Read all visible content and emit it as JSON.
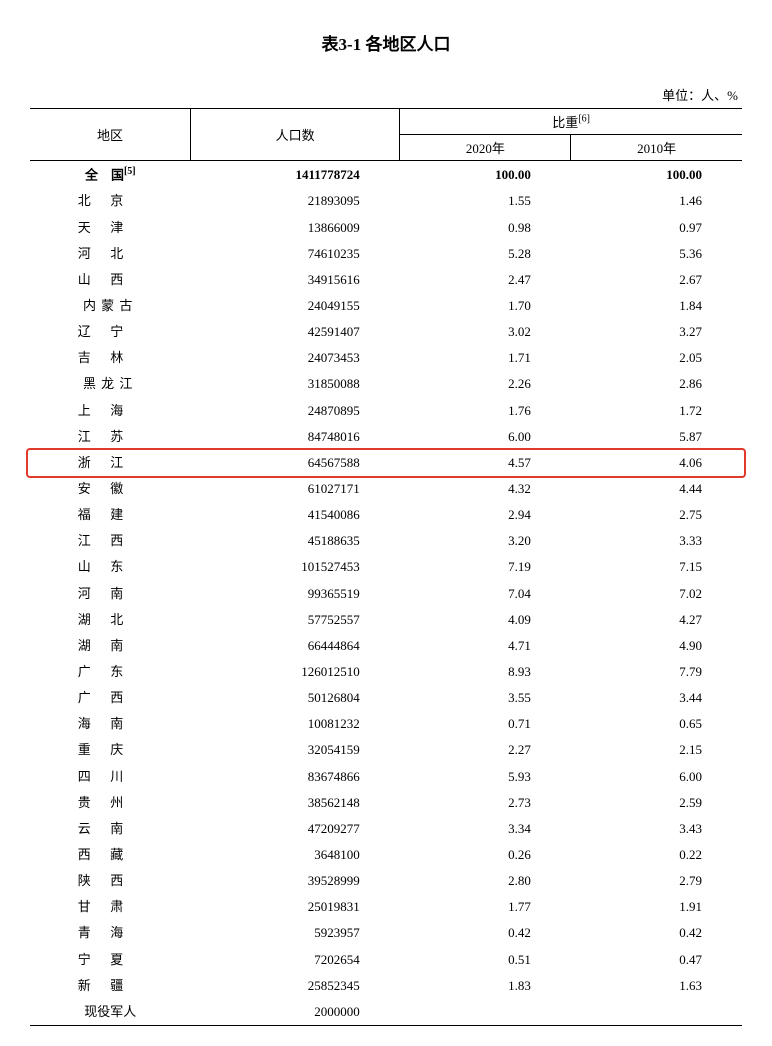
{
  "title": "表3-1 各地区人口",
  "unit_label": "单位：人、%",
  "headers": {
    "region": "地区",
    "population": "人口数",
    "share_group": "比重",
    "share_note": "[6]",
    "year_2020": "2020年",
    "year_2010": "2010年"
  },
  "total_row": {
    "region": "全　国",
    "note": "[5]",
    "population": "1411778724",
    "share_2020": "100.00",
    "share_2010": "100.00"
  },
  "rows": [
    {
      "region": "北京",
      "s": "s2",
      "population": "21893095",
      "share_2020": "1.55",
      "share_2010": "1.46"
    },
    {
      "region": "天津",
      "s": "s2",
      "population": "13866009",
      "share_2020": "0.98",
      "share_2010": "0.97"
    },
    {
      "region": "河北",
      "s": "s2",
      "population": "74610235",
      "share_2020": "5.28",
      "share_2010": "5.36"
    },
    {
      "region": "山西",
      "s": "s2",
      "population": "34915616",
      "share_2020": "2.47",
      "share_2010": "2.67"
    },
    {
      "region": "内蒙古",
      "s": "s3",
      "population": "24049155",
      "share_2020": "1.70",
      "share_2010": "1.84"
    },
    {
      "region": "辽宁",
      "s": "s2",
      "population": "42591407",
      "share_2020": "3.02",
      "share_2010": "3.27"
    },
    {
      "region": "吉林",
      "s": "s2",
      "population": "24073453",
      "share_2020": "1.71",
      "share_2010": "2.05"
    },
    {
      "region": "黑龙江",
      "s": "s3",
      "population": "31850088",
      "share_2020": "2.26",
      "share_2010": "2.86"
    },
    {
      "region": "上海",
      "s": "s2",
      "population": "24870895",
      "share_2020": "1.76",
      "share_2010": "1.72"
    },
    {
      "region": "江苏",
      "s": "s2",
      "population": "84748016",
      "share_2020": "6.00",
      "share_2010": "5.87"
    },
    {
      "region": "浙江",
      "s": "s2",
      "population": "64567588",
      "share_2020": "4.57",
      "share_2010": "4.06",
      "highlight": true
    },
    {
      "region": "安徽",
      "s": "s2",
      "population": "61027171",
      "share_2020": "4.32",
      "share_2010": "4.44"
    },
    {
      "region": "福建",
      "s": "s2",
      "population": "41540086",
      "share_2020": "2.94",
      "share_2010": "2.75"
    },
    {
      "region": "江西",
      "s": "s2",
      "population": "45188635",
      "share_2020": "3.20",
      "share_2010": "3.33"
    },
    {
      "region": "山东",
      "s": "s2",
      "population": "101527453",
      "share_2020": "7.19",
      "share_2010": "7.15"
    },
    {
      "region": "河南",
      "s": "s2",
      "population": "99365519",
      "share_2020": "7.04",
      "share_2010": "7.02"
    },
    {
      "region": "湖北",
      "s": "s2",
      "population": "57752557",
      "share_2020": "4.09",
      "share_2010": "4.27"
    },
    {
      "region": "湖南",
      "s": "s2",
      "population": "66444864",
      "share_2020": "4.71",
      "share_2010": "4.90"
    },
    {
      "region": "广东",
      "s": "s2",
      "population": "126012510",
      "share_2020": "8.93",
      "share_2010": "7.79"
    },
    {
      "region": "广西",
      "s": "s2",
      "population": "50126804",
      "share_2020": "3.55",
      "share_2010": "3.44"
    },
    {
      "region": "海南",
      "s": "s2",
      "population": "10081232",
      "share_2020": "0.71",
      "share_2010": "0.65"
    },
    {
      "region": "重庆",
      "s": "s2",
      "population": "32054159",
      "share_2020": "2.27",
      "share_2010": "2.15"
    },
    {
      "region": "四川",
      "s": "s2",
      "population": "83674866",
      "share_2020": "5.93",
      "share_2010": "6.00"
    },
    {
      "region": "贵州",
      "s": "s2",
      "population": "38562148",
      "share_2020": "2.73",
      "share_2010": "2.59"
    },
    {
      "region": "云南",
      "s": "s2",
      "population": "47209277",
      "share_2020": "3.34",
      "share_2010": "3.43"
    },
    {
      "region": "西藏",
      "s": "s2",
      "population": "3648100",
      "share_2020": "0.26",
      "share_2010": "0.22"
    },
    {
      "region": "陕西",
      "s": "s2",
      "population": "39528999",
      "share_2020": "2.80",
      "share_2010": "2.79"
    },
    {
      "region": "甘肃",
      "s": "s2",
      "population": "25019831",
      "share_2020": "1.77",
      "share_2010": "1.91"
    },
    {
      "region": "青海",
      "s": "s2",
      "population": "5923957",
      "share_2020": "0.42",
      "share_2010": "0.42"
    },
    {
      "region": "宁夏",
      "s": "s2",
      "population": "7202654",
      "share_2020": "0.51",
      "share_2010": "0.47"
    },
    {
      "region": "新疆",
      "s": "s2",
      "population": "25852345",
      "share_2020": "1.83",
      "share_2010": "1.63"
    },
    {
      "region": "现役军人",
      "s": "s4",
      "population": "2000000",
      "share_2020": "",
      "share_2010": ""
    }
  ],
  "chart_data": {
    "type": "table",
    "title": "表3-1 各地区人口",
    "columns": [
      "地区",
      "人口数",
      "比重2020年(%)",
      "比重2010年(%)"
    ],
    "note": "单位：人、%",
    "rows": [
      [
        "全国",
        1411778724,
        100.0,
        100.0
      ],
      [
        "北京",
        21893095,
        1.55,
        1.46
      ],
      [
        "天津",
        13866009,
        0.98,
        0.97
      ],
      [
        "河北",
        74610235,
        5.28,
        5.36
      ],
      [
        "山西",
        34915616,
        2.47,
        2.67
      ],
      [
        "内蒙古",
        24049155,
        1.7,
        1.84
      ],
      [
        "辽宁",
        42591407,
        3.02,
        3.27
      ],
      [
        "吉林",
        24073453,
        1.71,
        2.05
      ],
      [
        "黑龙江",
        31850088,
        2.26,
        2.86
      ],
      [
        "上海",
        24870895,
        1.76,
        1.72
      ],
      [
        "江苏",
        84748016,
        6.0,
        5.87
      ],
      [
        "浙江",
        64567588,
        4.57,
        4.06
      ],
      [
        "安徽",
        61027171,
        4.32,
        4.44
      ],
      [
        "福建",
        41540086,
        2.94,
        2.75
      ],
      [
        "江西",
        45188635,
        3.2,
        3.33
      ],
      [
        "山东",
        101527453,
        7.19,
        7.15
      ],
      [
        "河南",
        99365519,
        7.04,
        7.02
      ],
      [
        "湖北",
        57752557,
        4.09,
        4.27
      ],
      [
        "湖南",
        66444864,
        4.71,
        4.9
      ],
      [
        "广东",
        126012510,
        8.93,
        7.79
      ],
      [
        "广西",
        50126804,
        3.55,
        3.44
      ],
      [
        "海南",
        10081232,
        0.71,
        0.65
      ],
      [
        "重庆",
        32054159,
        2.27,
        2.15
      ],
      [
        "四川",
        83674866,
        5.93,
        6.0
      ],
      [
        "贵州",
        38562148,
        2.73,
        2.59
      ],
      [
        "云南",
        47209277,
        3.34,
        3.43
      ],
      [
        "西藏",
        3648100,
        0.26,
        0.22
      ],
      [
        "陕西",
        39528999,
        2.8,
        2.79
      ],
      [
        "甘肃",
        25019831,
        1.77,
        1.91
      ],
      [
        "青海",
        5923957,
        0.42,
        0.42
      ],
      [
        "宁夏",
        7202654,
        0.51,
        0.47
      ],
      [
        "新疆",
        25852345,
        1.83,
        1.63
      ],
      [
        "现役军人",
        2000000,
        null,
        null
      ]
    ]
  }
}
